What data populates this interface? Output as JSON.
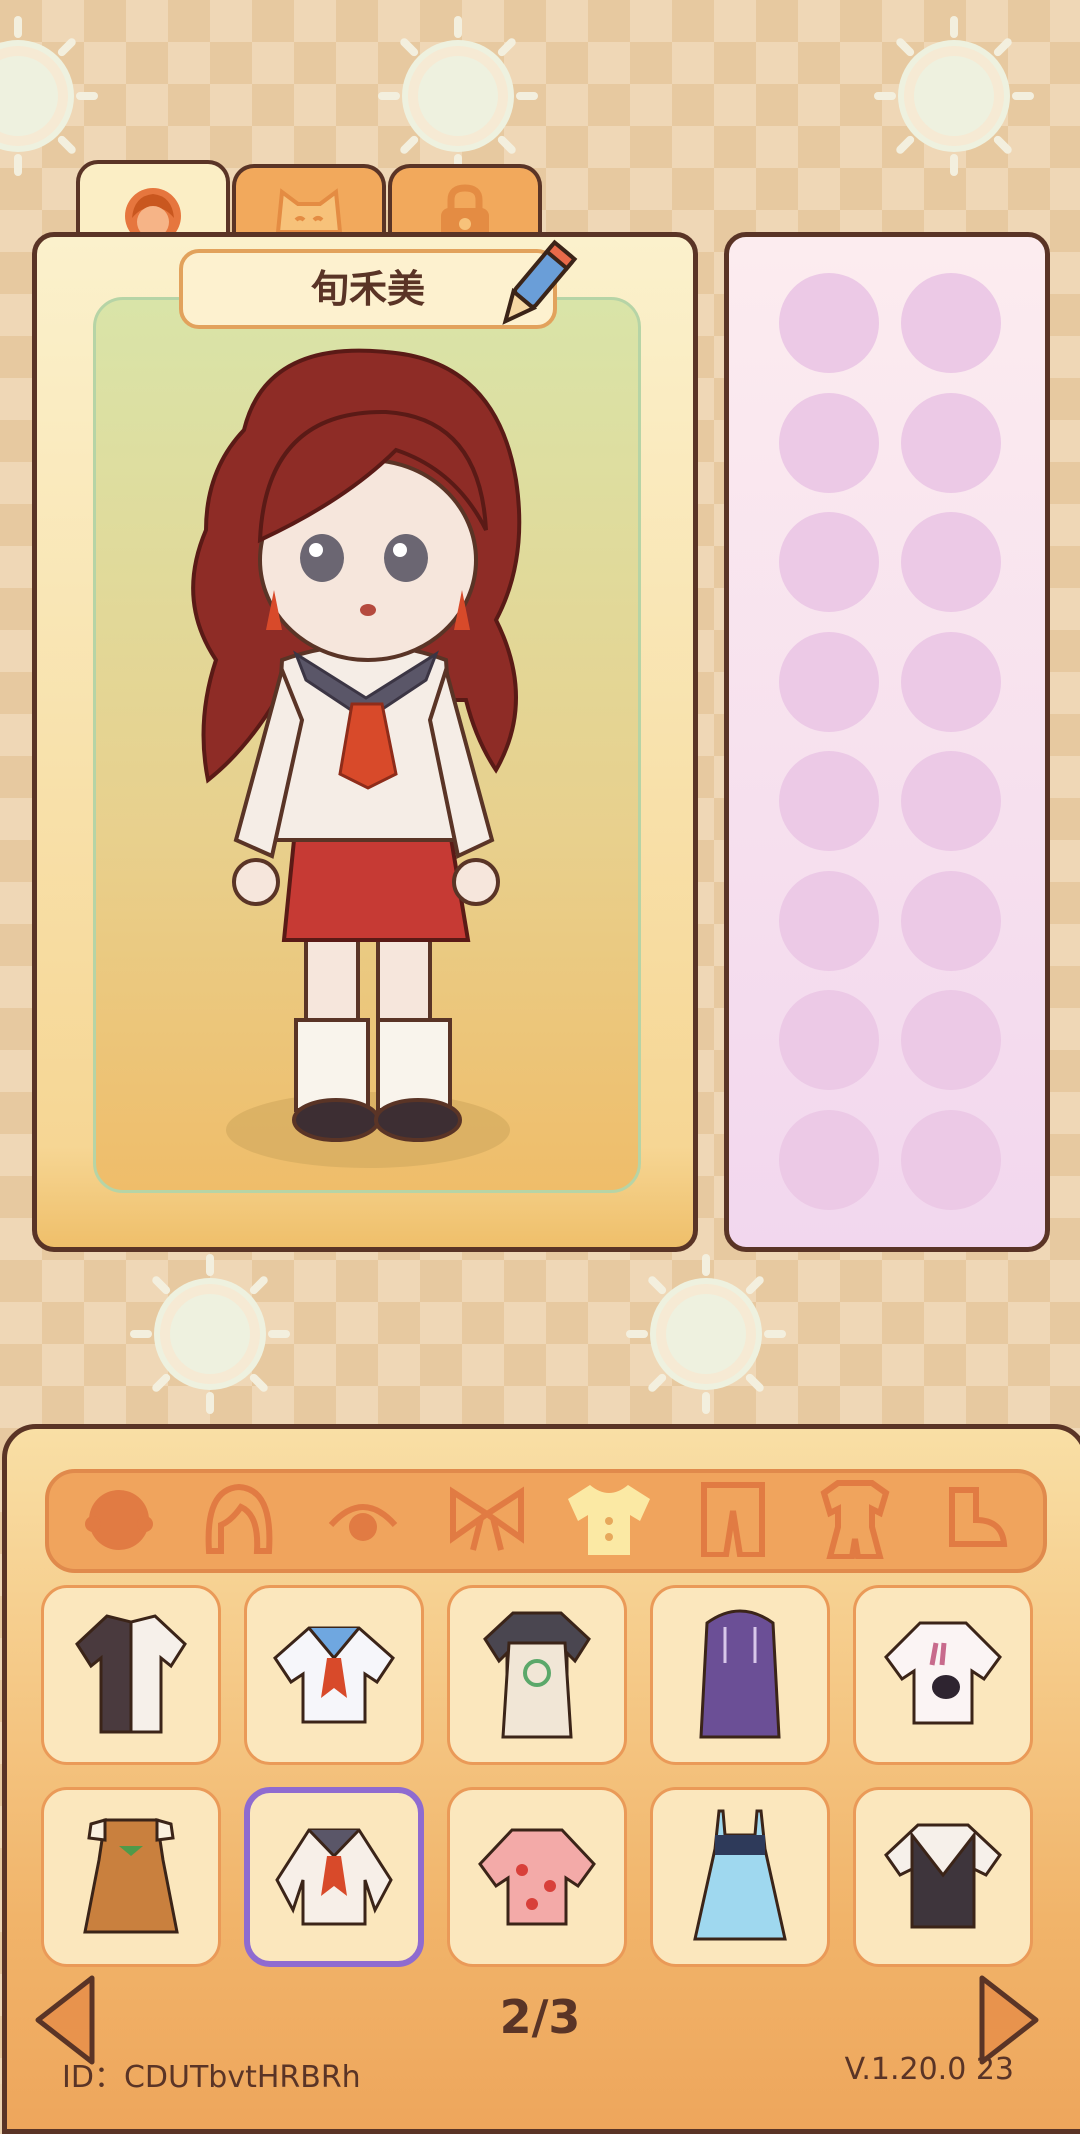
{
  "character": {
    "name": "旬禾美"
  },
  "tabs": [
    {
      "icon": "girl-face-icon",
      "active": true
    },
    {
      "icon": "cat-face-icon",
      "active": false
    },
    {
      "icon": "lock-icon",
      "active": false
    }
  ],
  "accessory_slots": 16,
  "categories": [
    {
      "icon": "head-icon",
      "active": false
    },
    {
      "icon": "hair-icon",
      "active": false
    },
    {
      "icon": "eye-icon",
      "active": false
    },
    {
      "icon": "bow-icon",
      "active": false
    },
    {
      "icon": "shirt-icon",
      "active": true
    },
    {
      "icon": "pants-icon",
      "active": false
    },
    {
      "icon": "outfit-icon",
      "active": false
    },
    {
      "icon": "shoe-icon",
      "active": false
    }
  ],
  "clothing_items": [
    {
      "icon": "black-white-shirt-icon",
      "selected": false
    },
    {
      "icon": "sailor-shirt-icon",
      "selected": false
    },
    {
      "icon": "snail-apron-shirt-icon",
      "selected": false
    },
    {
      "icon": "purple-hoodie-icon",
      "selected": false
    },
    {
      "icon": "bunny-hoodie-icon",
      "selected": false
    },
    {
      "icon": "orange-dress-icon",
      "selected": false
    },
    {
      "icon": "sailor-uniform-icon",
      "selected": true
    },
    {
      "icon": "strawberry-shirt-icon",
      "selected": false
    },
    {
      "icon": "blue-dress-icon",
      "selected": false
    },
    {
      "icon": "vest-shirt-icon",
      "selected": false
    }
  ],
  "pagination": {
    "label": "2/3"
  },
  "footer": {
    "id_text": "ID：CDUTbvtHRBRh",
    "version": "V.1.20.0  23"
  },
  "colors": {
    "outline": "#5a3426",
    "accent": "#f0a45d",
    "selected": "#8f6bd0"
  }
}
